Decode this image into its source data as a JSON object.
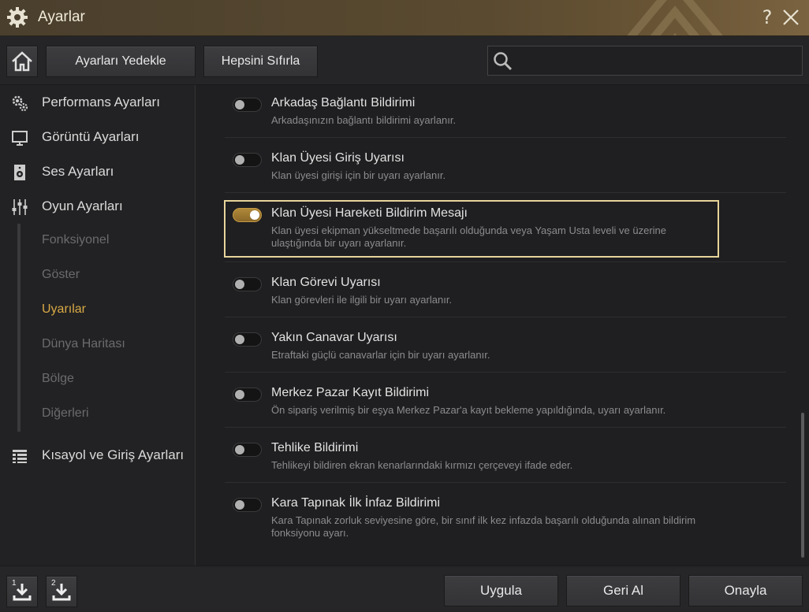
{
  "window": {
    "title": "Ayarlar",
    "help_icon": "question-icon",
    "help_label": "?",
    "close_icon": "close-icon"
  },
  "toolbar": {
    "home_icon": "home-icon",
    "backup_label": "Ayarları Yedekle",
    "reset_label": "Hepsini Sıfırla",
    "search_value": "",
    "search_placeholder": ""
  },
  "sidebar": {
    "items": [
      {
        "label": "Performans Ayarları",
        "icon": "gears-icon"
      },
      {
        "label": "Görüntü Ayarları",
        "icon": "monitor-icon"
      },
      {
        "label": "Ses Ayarları",
        "icon": "speaker-icon"
      },
      {
        "label": "Oyun Ayarları",
        "icon": "sliders-icon"
      },
      {
        "label": "Kısayol ve Giriş Ayarları",
        "icon": "list-icon"
      }
    ],
    "subitems": [
      {
        "label": "Fonksiyonel"
      },
      {
        "label": "Göster"
      },
      {
        "label": "Uyarılar",
        "active": true
      },
      {
        "label": "Dünya Haritası"
      },
      {
        "label": "Bölge"
      },
      {
        "label": "Diğerleri"
      }
    ]
  },
  "settings": [
    {
      "title": "Arkadaş Bağlantı Bildirimi",
      "desc": "Arkadaşınızın bağlantı bildirimi ayarlanır.",
      "on": false
    },
    {
      "title": "Klan Üyesi Giriş Uyarısı",
      "desc": "Klan üyesi girişi için bir uyarı ayarlanır.",
      "on": false
    },
    {
      "title": "Klan Üyesi Hareketi Bildirim Mesajı",
      "desc": "Klan üyesi ekipman yükseltmede başarılı olduğunda veya Yaşam Usta leveli ve üzerine ulaştığında bir uyarı ayarlanır.",
      "on": true
    },
    {
      "title": "Klan Görevi Uyarısı",
      "desc": "Klan görevleri ile ilgili bir uyarı ayarlanır.",
      "on": false
    },
    {
      "title": "Yakın Canavar Uyarısı",
      "desc": "Etraftaki güçlü canavarlar için bir uyarı ayarlanır.",
      "on": false
    },
    {
      "title": "Merkez Pazar Kayıt Bildirimi",
      "desc": "Ön sipariş verilmiş bir eşya Merkez Pazar'a kayıt bekleme yapıldığında, uyarı ayarlanır.",
      "on": false
    },
    {
      "title": "Tehlike Bildirimi",
      "desc": "Tehlikeyi bildiren ekran kenarlarındaki kırmızı çerçeveyi ifade eder.",
      "on": false
    },
    {
      "title": "Kara Tapınak İlk İnfaz Bildirimi",
      "desc": "Kara Tapınak zorluk seviyesine göre, bir sınıf ilk kez infazda başarılı olduğunda alınan bildirim fonksiyonu ayarı.",
      "on": false
    }
  ],
  "bottom": {
    "download1_num": "1",
    "download2_num": "2",
    "apply_label": "Uygula",
    "revert_label": "Geri Al",
    "confirm_label": "Onayla"
  },
  "colors": {
    "accent": "#d8a945",
    "highlight_border": "#e8d49a",
    "toggle_on": "#b0883a"
  }
}
